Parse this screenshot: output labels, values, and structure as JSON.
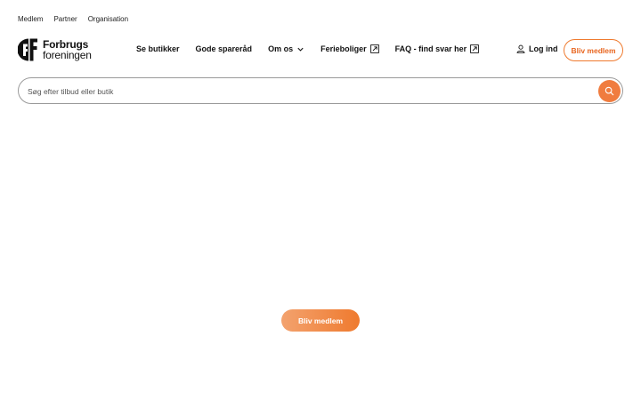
{
  "topbar": {
    "links": [
      "Medlem",
      "Partner",
      "Organisation"
    ]
  },
  "logo": {
    "line1": "Forbrugs",
    "line2": "foreningen",
    "icon": "forbrugsforeningen-logo-icon"
  },
  "nav": {
    "items": [
      {
        "label": "Se butikker"
      },
      {
        "label": "Gode spareråd"
      },
      {
        "label": "Om os",
        "icon": "chevron-down-icon"
      },
      {
        "label": "Ferieboliger",
        "icon": "external-link-icon"
      },
      {
        "label": "FAQ - find svar her",
        "icon": "external-link-icon"
      }
    ]
  },
  "account": {
    "login_label": "Log ind",
    "login_icon": "user-icon",
    "join_label": "Bliv medlem"
  },
  "search": {
    "placeholder": "Søg efter tilbud eller butik",
    "button_icon": "search-icon"
  },
  "main": {
    "cta_label": "Bliv medlem"
  },
  "colors": {
    "accent": "#ef7a2e",
    "accent_light": "#f3a26e",
    "text": "#111111",
    "border": "#9a9a9a"
  }
}
